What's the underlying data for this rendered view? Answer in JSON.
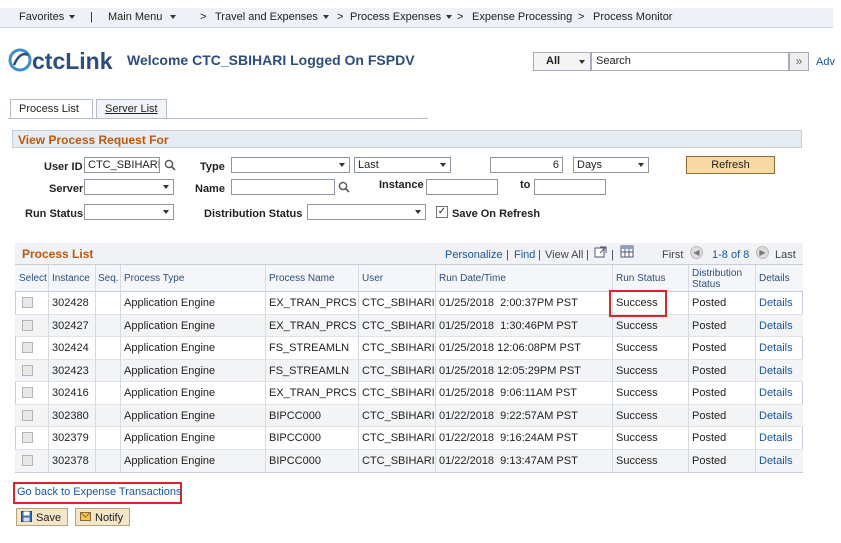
{
  "nav": {
    "favorites": "Favorites",
    "main_menu": "Main Menu",
    "breadcrumbs": [
      "Travel and Expenses",
      "Process Expenses",
      "Expense Processing",
      "Process Monitor"
    ]
  },
  "header": {
    "logo_text": "ctcLink",
    "welcome": "Welcome CTC_SBIHARI Logged On FSPDV",
    "search_scope": "All",
    "search_value": "Search",
    "advanced": "Adv"
  },
  "tabs": [
    {
      "label": "Process List",
      "active": true
    },
    {
      "label": "Server List",
      "active": false
    }
  ],
  "criteria": {
    "title": "View Process Request For",
    "user_id_label": "User ID",
    "user_id_value": "CTC_SBIHARI",
    "type_label": "Type",
    "type_value": "",
    "last_value": "Last",
    "count_value": "6",
    "unit_value": "Days",
    "refresh_label": "Refresh",
    "server_label": "Server",
    "server_value": "",
    "name_label": "Name",
    "name_value": "",
    "instance_label": "Instance",
    "instance_from": "",
    "to_label": "to",
    "instance_to": "",
    "run_status_label": "Run Status",
    "run_status_value": "",
    "dist_status_label": "Distribution Status",
    "dist_status_value": "",
    "save_on_refresh_label": "Save On Refresh",
    "save_on_refresh_checked": true
  },
  "grid": {
    "title": "Process List",
    "personalize": "Personalize",
    "find": "Find",
    "view_all": "View All",
    "first": "First",
    "range": "1-8 of 8",
    "last": "Last",
    "columns": {
      "select": "Select",
      "instance": "Instance",
      "seq": "Seq.",
      "process_type": "Process Type",
      "process_name": "Process Name",
      "user": "User",
      "run_datetime": "Run Date/Time",
      "run_status": "Run Status",
      "dist_status_1": "Distribution",
      "dist_status_2": "Status",
      "details": "Details"
    },
    "rows": [
      {
        "instance": "302428",
        "seq": "",
        "type": "Application Engine",
        "name": "EX_TRAN_PRCS",
        "user": "CTC_SBIHARI",
        "datetime": "01/25/2018  2:00:37PM PST",
        "status": "Success",
        "dist": "Posted",
        "details": "Details"
      },
      {
        "instance": "302427",
        "seq": "",
        "type": "Application Engine",
        "name": "EX_TRAN_PRCS",
        "user": "CTC_SBIHARI",
        "datetime": "01/25/2018  1:30:46PM PST",
        "status": "Success",
        "dist": "Posted",
        "details": "Details"
      },
      {
        "instance": "302424",
        "seq": "",
        "type": "Application Engine",
        "name": "FS_STREAMLN",
        "user": "CTC_SBIHARI",
        "datetime": "01/25/2018 12:06:08PM PST",
        "status": "Success",
        "dist": "Posted",
        "details": "Details"
      },
      {
        "instance": "302423",
        "seq": "",
        "type": "Application Engine",
        "name": "FS_STREAMLN",
        "user": "CTC_SBIHARI",
        "datetime": "01/25/2018 12:05:29PM PST",
        "status": "Success",
        "dist": "Posted",
        "details": "Details"
      },
      {
        "instance": "302416",
        "seq": "",
        "type": "Application Engine",
        "name": "EX_TRAN_PRCS",
        "user": "CTC_SBIHARI",
        "datetime": "01/25/2018  9:06:11AM PST",
        "status": "Success",
        "dist": "Posted",
        "details": "Details"
      },
      {
        "instance": "302380",
        "seq": "",
        "type": "Application Engine",
        "name": "BIPCC000",
        "user": "CTC_SBIHARI",
        "datetime": "01/22/2018  9:22:57AM PST",
        "status": "Success",
        "dist": "Posted",
        "details": "Details"
      },
      {
        "instance": "302379",
        "seq": "",
        "type": "Application Engine",
        "name": "BIPCC000",
        "user": "CTC_SBIHARI",
        "datetime": "01/22/2018  9:16:24AM PST",
        "status": "Success",
        "dist": "Posted",
        "details": "Details"
      },
      {
        "instance": "302378",
        "seq": "",
        "type": "Application Engine",
        "name": "BIPCC000",
        "user": "CTC_SBIHARI",
        "datetime": "01/22/2018  9:13:47AM PST",
        "status": "Success",
        "dist": "Posted",
        "details": "Details"
      }
    ]
  },
  "footer": {
    "back_link": "Go back to Expense Transactions",
    "save": "Save",
    "notify": "Notify"
  },
  "colors": {
    "accent_orange": "#c0580b",
    "link_blue": "#1a55a3",
    "highlight_red": "#d9262b"
  }
}
